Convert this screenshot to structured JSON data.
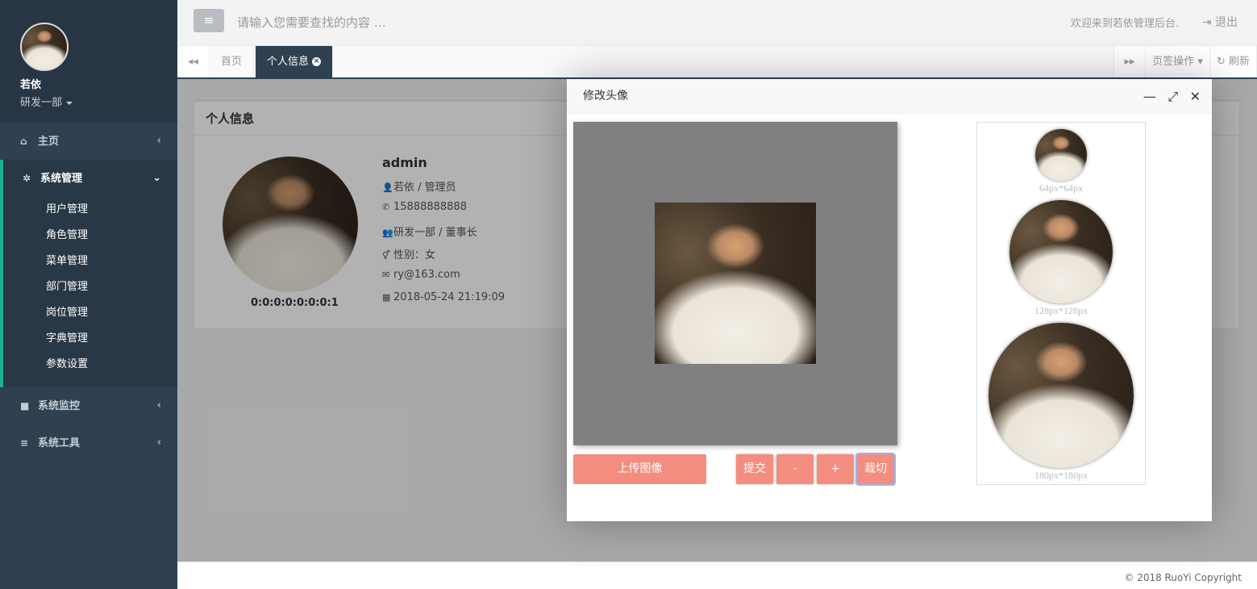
{
  "sidebar": {
    "user_name": "若依",
    "user_dept": "研发一部",
    "menus": [
      {
        "label": "主页",
        "icon": "home-icon"
      },
      {
        "label": "系统管理",
        "icon": "gear-icon"
      },
      {
        "label": "系统监控",
        "icon": "video-icon"
      },
      {
        "label": "系统工具",
        "icon": "bars-icon"
      }
    ],
    "submenu": [
      "用户管理",
      "角色管理",
      "菜单管理",
      "部门管理",
      "岗位管理",
      "字典管理",
      "参数设置"
    ]
  },
  "topbar": {
    "search_placeholder": "请输入您需要查找的内容 …",
    "welcome": "欢迎来到若依管理后台.",
    "logout": "退出"
  },
  "tabs": {
    "items": [
      "首页",
      "个人信息"
    ],
    "tab_ops": "页签操作",
    "refresh": "刷新"
  },
  "profile_panel": {
    "title": "个人信息",
    "login_name": "admin",
    "user_id": "0:0:0:0:0:0:0:1",
    "name_role": "若依 / 管理员",
    "phone": "15888888888",
    "dept_post": "研发一部 / 董事长",
    "gender": "性别：女",
    "email": "ry@163.com",
    "created": "2018-05-24 21:19:09"
  },
  "modal": {
    "title": "修改头像",
    "upload_label": "上传图像",
    "submit_label": "提交",
    "zoom_out_label": "-",
    "zoom_in_label": "+",
    "crop_label": "裁切",
    "previews": [
      "64px*64px",
      "128px*128px",
      "180px*180px"
    ]
  },
  "footer": {
    "copyright": "© 2018 RuoYi Copyright"
  }
}
